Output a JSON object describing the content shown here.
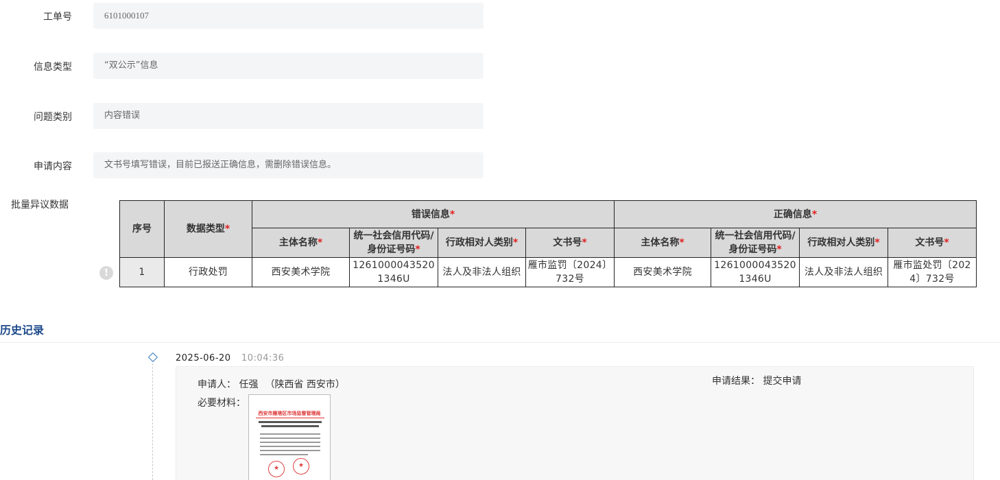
{
  "form": {
    "order_no": {
      "label": "工单号",
      "value": "6101000107"
    },
    "info_type": {
      "label": "信息类型",
      "value": "“双公示”信息"
    },
    "issue_type": {
      "label": "问题类别",
      "value": "内容错误"
    },
    "request": {
      "label": "申请内容",
      "value": "文书号填写错误，目前已报送正确信息，需删除错误信息。"
    }
  },
  "batch": {
    "label": "批量异议数据",
    "warn_icon": "exclamation-icon",
    "headers": {
      "seq": "序号",
      "data_type": "数据类型",
      "wrong_group": "错误信息",
      "correct_group": "正确信息",
      "subject": "主体名称",
      "credit_code_line1": "统一社会信用代码/",
      "credit_code_line2": "身份证号码",
      "counterpart_type": "行政相对人类别",
      "doc_no": "文书号",
      "required_mark": "*"
    },
    "rows": [
      {
        "seq": "1",
        "data_type": "行政处罚",
        "wrong": {
          "subject": "西安美术学院",
          "credit_code": "12610000435201346U",
          "counterpart_type": "法人及非法人组织",
          "doc_no": "雁市监罚〔2024〕732号"
        },
        "correct": {
          "subject": "西安美术学院",
          "credit_code": "12610000435201346U",
          "counterpart_type": "法人及非法人组织",
          "doc_no": "雁市监处罚〔2024〕732号"
        }
      }
    ]
  },
  "history": {
    "title": "历史记录",
    "entries": [
      {
        "date": "2025-06-20",
        "time": "10:04:36",
        "applicant_label": "申请人：",
        "applicant": "任强",
        "region": "（陕西省 西安市）",
        "result_label": "申请结果：",
        "result": "提交申请",
        "materials_label": "必要材料：",
        "material_header": "西安市雁塔区市场监督管理局"
      }
    ]
  },
  "colors": {
    "accent": "#1e4a8a",
    "required": "#e02020",
    "input_bg": "#f4f5f7",
    "header_bg": "#d9d9d9"
  }
}
